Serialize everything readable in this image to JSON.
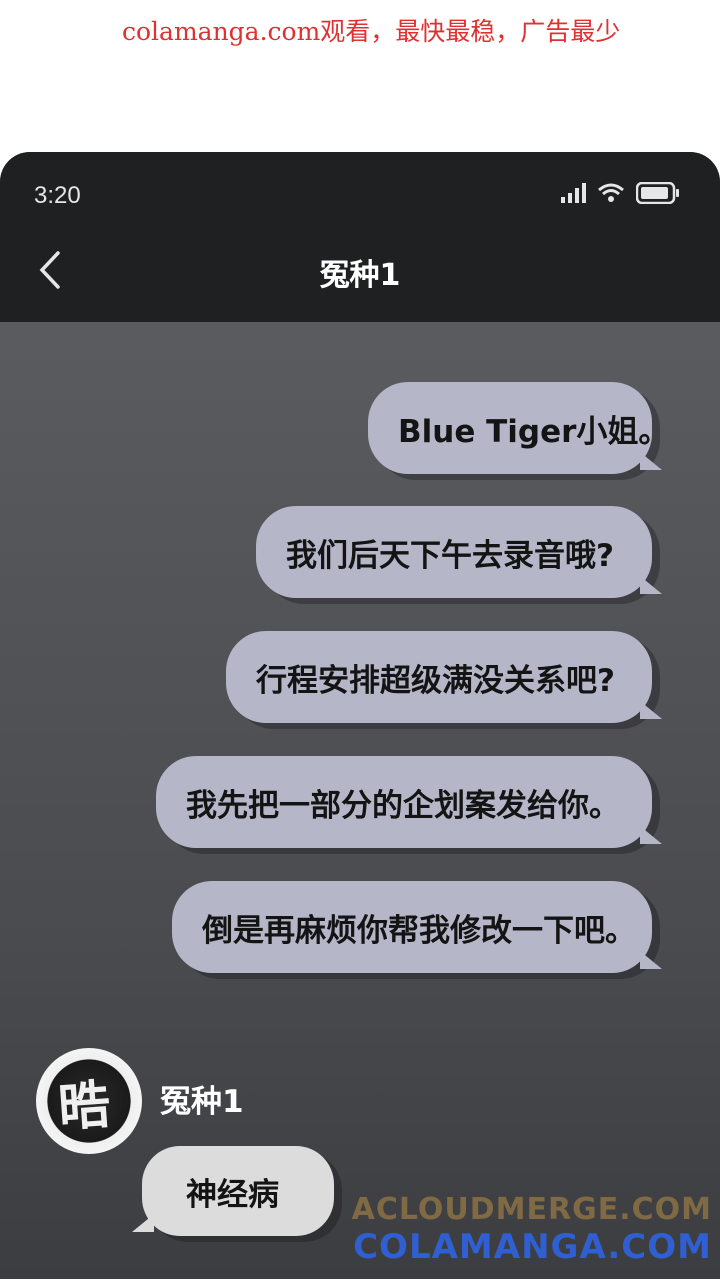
{
  "banner": {
    "text": "colamanga.com观看，最快最稳，广告最少"
  },
  "status_bar": {
    "time": "3:20",
    "icons": [
      "signal-icon",
      "wifi-icon",
      "battery-icon"
    ]
  },
  "header": {
    "title": "冤种1",
    "back_icon": "chevron-left-icon"
  },
  "messages_out": [
    "Blue Tiger小姐。",
    "我们后天下午去录音哦?",
    "行程安排超级满没关系吧?",
    "我先把一部分的企划案发给你。",
    "倒是再麻烦你帮我修改一下吧。"
  ],
  "incoming": {
    "sender": "冤种1",
    "avatar_text": "晧",
    "message": "神经病"
  },
  "watermark": {
    "line1": "ACLOUDMERGE.COM",
    "line2": "COLAMANGA.COM"
  },
  "colors": {
    "banner_red": "#e03030",
    "bubble_out": "#b6b6c9",
    "bubble_in": "#dcdcdc",
    "topbar": "#1f2022"
  }
}
